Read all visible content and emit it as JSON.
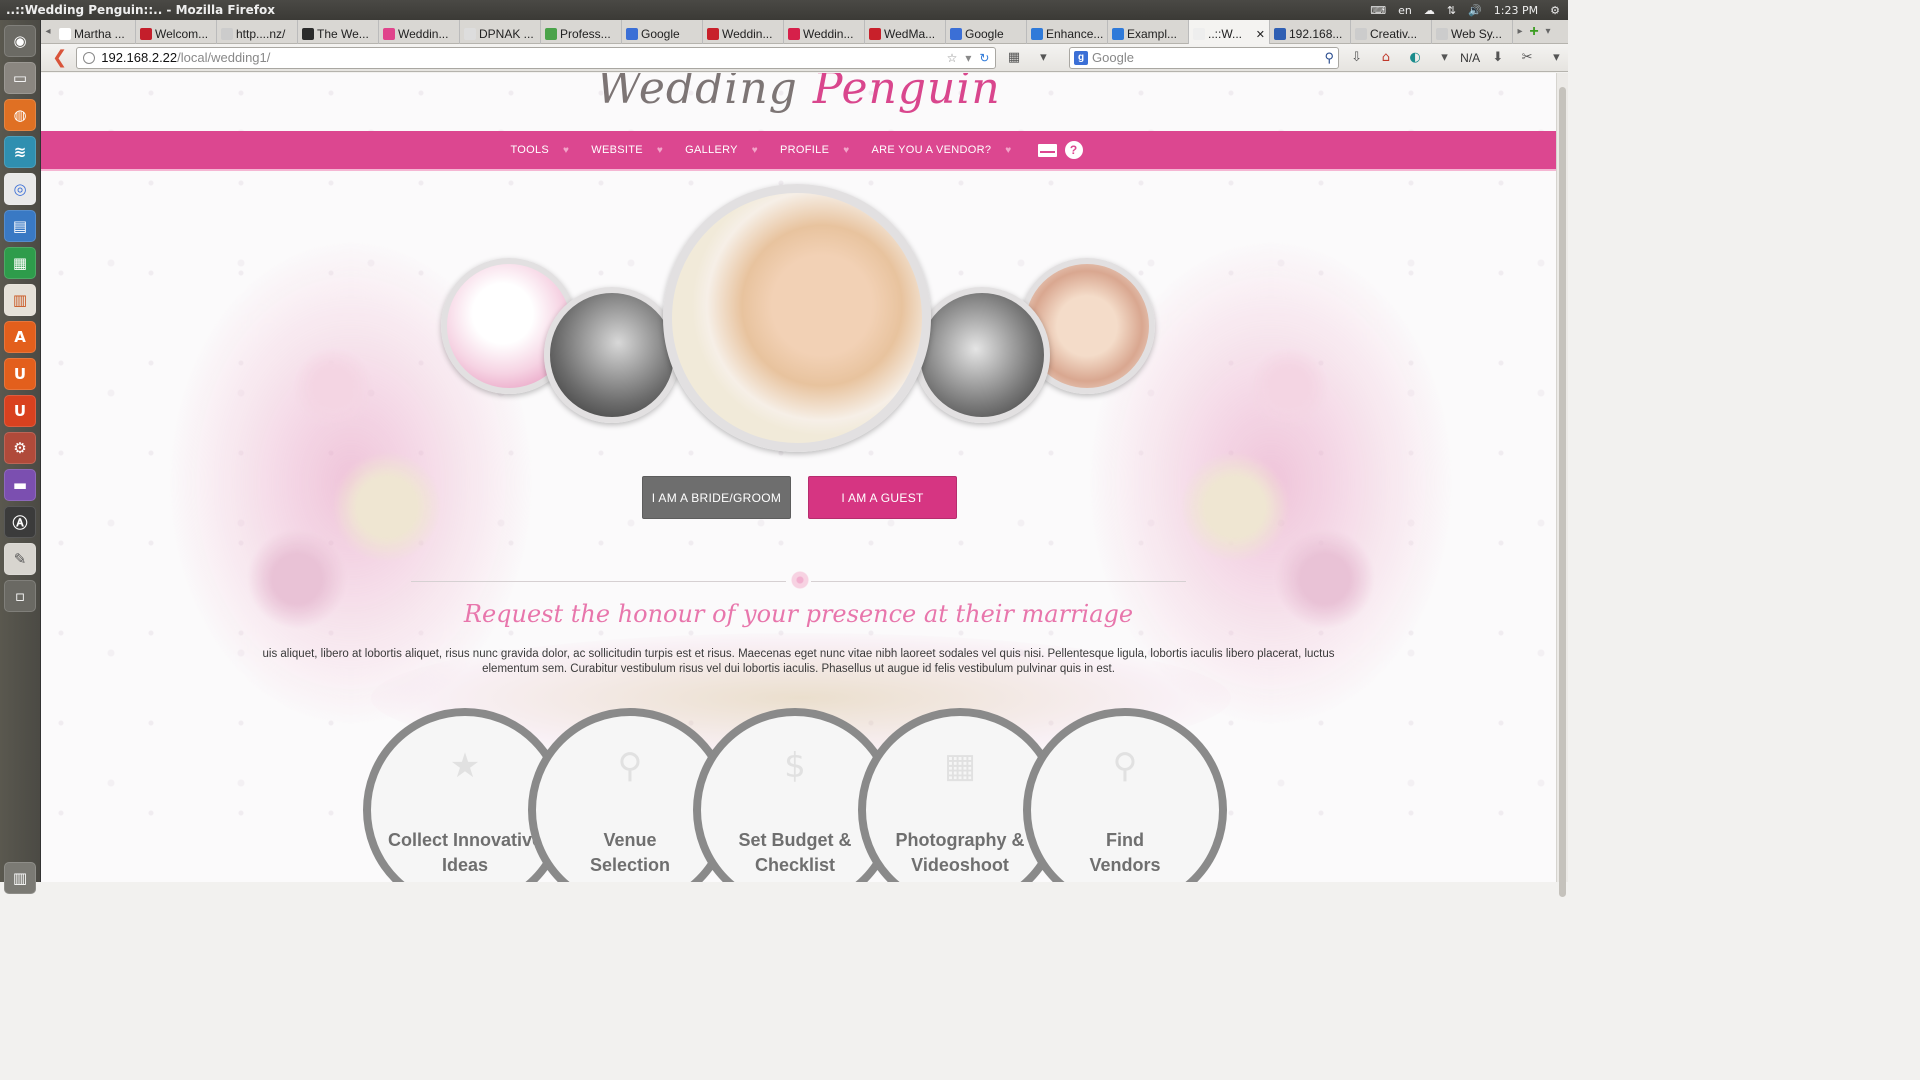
{
  "window": {
    "title": "..::Wedding Penguin::.. - Mozilla Firefox"
  },
  "system_tray": {
    "lang": "en",
    "time": "1:23 PM"
  },
  "tabs": [
    {
      "label": "Martha ...",
      "color": "#ffffff"
    },
    {
      "label": "Welcom...",
      "color": "#c41e2b"
    },
    {
      "label": "http....nz/",
      "color": "#cccccc"
    },
    {
      "label": "The We...",
      "color": "#2b2b2b"
    },
    {
      "label": "Weddin...",
      "color": "#e0448c"
    },
    {
      "label": "DPNAK ...",
      "color": "#dddddd"
    },
    {
      "label": "Profess...",
      "color": "#4aa34a"
    },
    {
      "label": "Google",
      "color": "#3b6fd6"
    },
    {
      "label": "Weddin...",
      "color": "#c8202a"
    },
    {
      "label": "Weddin...",
      "color": "#d6204a"
    },
    {
      "label": "WedMa...",
      "color": "#c8202a"
    },
    {
      "label": "Google",
      "color": "#3b6fd6"
    },
    {
      "label": "Enhance...",
      "color": "#2f7ad9"
    },
    {
      "label": "Exampl...",
      "color": "#2f7ad9"
    },
    {
      "label": "..::W...",
      "color": "#eeeeee",
      "active": true
    },
    {
      "label": "192.168...",
      "color": "#2f5fb3"
    },
    {
      "label": "Creativ...",
      "color": "#cccccc"
    },
    {
      "label": "Web Sy...",
      "color": "#cccccc"
    }
  ],
  "navbar": {
    "url_host": "192.168.2.22",
    "url_path": "/local/wedding1/",
    "search_placeholder": "Google",
    "na_label": "N/A"
  },
  "site": {
    "logo_part1": "Wedding",
    "logo_part2": "Penguin",
    "menu": [
      "TOOLS",
      "WEBSITE",
      "GALLERY",
      "PROFILE",
      "ARE YOU A VENDOR?"
    ],
    "buttons": {
      "bride": "I AM A BRIDE/GROOM",
      "guest": "I AM A GUEST"
    },
    "invite_heading": "Request the honour of your presence at their marriage",
    "lorem": "uis aliquet, libero at lobortis aliquet, risus nunc gravida dolor, ac sollicitudin turpis est et risus. Maecenas eget nunc vitae nibh laoreet sodales vel quis nisi. Pellentesque ligula, lobortis iaculis libero placerat, luctus elementum sem. Curabitur vestibulum risus vel dui lobortis iaculis. Phasellus ut augue id felis vestibulum pulvinar quis in est.",
    "features": [
      {
        "label": "Collect Innovative\nIdeas",
        "icon": "star-icon"
      },
      {
        "label": "Venue\nSelection",
        "icon": "map-pin-icon"
      },
      {
        "label": "Set Budget &\nChecklist",
        "icon": "dollar-icon"
      },
      {
        "label": "Photography &\nVideoshoot",
        "icon": "film-icon"
      },
      {
        "label": "Find\nVendors",
        "icon": "search-icon"
      }
    ]
  },
  "colors": {
    "brand_pink": "#dc4790",
    "guest_button": "#d63582",
    "bride_button": "#6e6e6e"
  }
}
